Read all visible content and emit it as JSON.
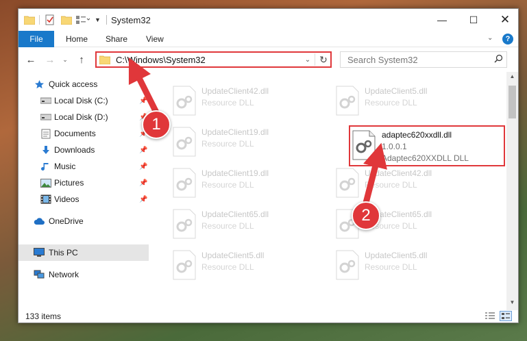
{
  "window": {
    "title": "System32",
    "controls": {
      "minimize": "—",
      "maximize": "☐",
      "close": "✕"
    }
  },
  "ribbon": {
    "tabs": [
      {
        "label": "File",
        "active": true
      },
      {
        "label": "Home"
      },
      {
        "label": "Share"
      },
      {
        "label": "View"
      }
    ]
  },
  "navigation": {
    "address": "C:\\Windows\\System32",
    "search_placeholder": "Search System32"
  },
  "sidebar": {
    "items": [
      {
        "label": "Quick access",
        "icon": "star-icon"
      },
      {
        "label": "Local Disk (C:)",
        "icon": "drive-icon",
        "pinned": true
      },
      {
        "label": "Local Disk (D:)",
        "icon": "drive-icon",
        "pinned": true
      },
      {
        "label": "Documents",
        "icon": "documents-icon",
        "pinned": true
      },
      {
        "label": "Downloads",
        "icon": "download-icon",
        "pinned": true
      },
      {
        "label": "Music",
        "icon": "music-icon",
        "pinned": true
      },
      {
        "label": "Pictures",
        "icon": "pictures-icon",
        "pinned": true
      },
      {
        "label": "Videos",
        "icon": "videos-icon",
        "pinned": true
      },
      {
        "label": "OneDrive",
        "icon": "cloud-icon"
      },
      {
        "label": "This PC",
        "icon": "computer-icon",
        "selected": true
      },
      {
        "label": "Network",
        "icon": "network-icon"
      }
    ]
  },
  "files": {
    "faded": [
      {
        "name": "UpdateClient42.dll",
        "desc": "Resource DLL"
      },
      {
        "name": "UpdateClient5.dll",
        "desc": "Resource DLL"
      },
      {
        "name": "UpdateClient19.dll",
        "desc": "Resource DLL"
      },
      {
        "name": "UpdateClient19.dll",
        "desc": "Resource DLL"
      },
      {
        "name": "UpdateClient42.dll",
        "desc": "Resource DLL"
      },
      {
        "name": "UpdateClient65.dll",
        "desc": "Resource DLL"
      },
      {
        "name": "UpdateClient65.dll",
        "desc": "Resource DLL"
      },
      {
        "name": "UpdateClient5.dll",
        "desc": "Resource DLL"
      },
      {
        "name": "UpdateClient5.dll",
        "desc": "Resource DLL"
      }
    ],
    "highlighted": {
      "name": "adaptec620xxdll.dll",
      "version": "1.0.0.1",
      "description": "Adaptec620XXDLL DLL"
    }
  },
  "status": {
    "item_count": "133 items"
  },
  "annotations": {
    "step1": "1",
    "step2": "2",
    "color": "#e0373a"
  }
}
